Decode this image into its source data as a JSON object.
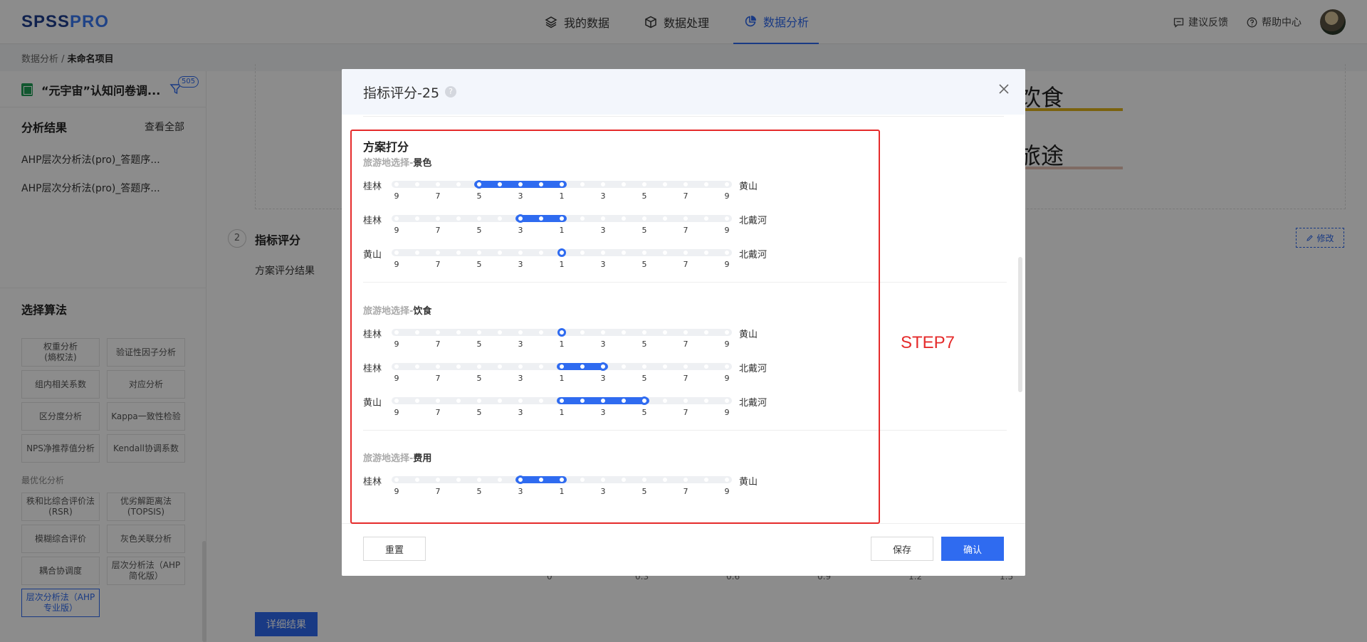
{
  "logo": {
    "part1": "SPSS",
    "part2": "PRO"
  },
  "nav": [
    {
      "label": "我的数据",
      "icon": "layers-icon",
      "active": false
    },
    {
      "label": "数据处理",
      "icon": "cube-icon",
      "active": false
    },
    {
      "label": "数据分析",
      "icon": "pie-chart-icon",
      "active": true
    }
  ],
  "header_right": {
    "feedback": "建议反馈",
    "help": "帮助中心"
  },
  "breadcrumb": {
    "root": "数据分析 / ",
    "current": "未命名项目"
  },
  "sidebar": {
    "file_name": "“元宇宙”认知问卷调...",
    "filter_count": "505",
    "results_title": "分析结果",
    "view_all": "查看全部",
    "results": [
      "AHP层次分析法(pro)_答题序...",
      "AHP层次分析法(pro)_答题序..."
    ],
    "algo_title": "选择算法",
    "algos": [
      {
        "label": "权重分析\n(熵权法)"
      },
      {
        "label": "验证性因子分析"
      },
      {
        "label": "组内相关系数"
      },
      {
        "label": "对应分析"
      },
      {
        "label": "区分度分析"
      },
      {
        "label": "Kappa一致性检验"
      },
      {
        "label": "NPS净推荐值分析"
      },
      {
        "label": "Kendall协调系数"
      }
    ],
    "category": "最优化分析",
    "algos2": [
      {
        "label": "秩和比综合评价法\n(RSR)"
      },
      {
        "label": "优劣解距离法\n(TOPSIS)"
      },
      {
        "label": "模糊综合评价"
      },
      {
        "label": "灰色关联分析"
      },
      {
        "label": "耦合协调度"
      },
      {
        "label": "层次分析法（AHP\n简化版）"
      },
      {
        "label": "层次分析法（AHP\n专业版）",
        "selected": true
      }
    ]
  },
  "main": {
    "bg_labels": [
      "饮食",
      "旅途"
    ],
    "step_num": "2",
    "step_title": "指标评分",
    "step_sub": "方案评分结果",
    "edit": "修改",
    "axis": [
      "0",
      "0.3",
      "0.6",
      "0.9",
      "1.2",
      "1.5"
    ],
    "detail_button": "详细结果"
  },
  "modal": {
    "title": "指标评分-25",
    "help": "?",
    "block_title": "方案打分",
    "criterion_prefix": "旅游地选择-",
    "tick_labels": [
      "9",
      "7",
      "5",
      "3",
      "1",
      "3",
      "5",
      "7",
      "9"
    ],
    "groups": [
      {
        "criterion": "景色",
        "rows": [
          {
            "left": "桂林",
            "right": "黄山",
            "value": 2
          },
          {
            "left": "桂林",
            "right": "北戴河",
            "value": 3
          },
          {
            "left": "黄山",
            "right": "北戴河",
            "value": 4
          }
        ]
      },
      {
        "criterion": "饮食",
        "rows": [
          {
            "left": "桂林",
            "right": "黄山",
            "value": 4
          },
          {
            "left": "桂林",
            "right": "北戴河",
            "value": 5
          },
          {
            "left": "黄山",
            "right": "北戴河",
            "value": 6
          }
        ]
      },
      {
        "criterion": "费用",
        "rows": [
          {
            "left": "桂林",
            "right": "黄山",
            "value": 3
          }
        ]
      }
    ],
    "reset": "重置",
    "save": "保存",
    "confirm": "确认"
  },
  "annotation": {
    "label": "STEP7",
    "color": "#e52b2b"
  },
  "colors": {
    "accent": "#2f6bf0",
    "brand": "#1f3f8f"
  }
}
